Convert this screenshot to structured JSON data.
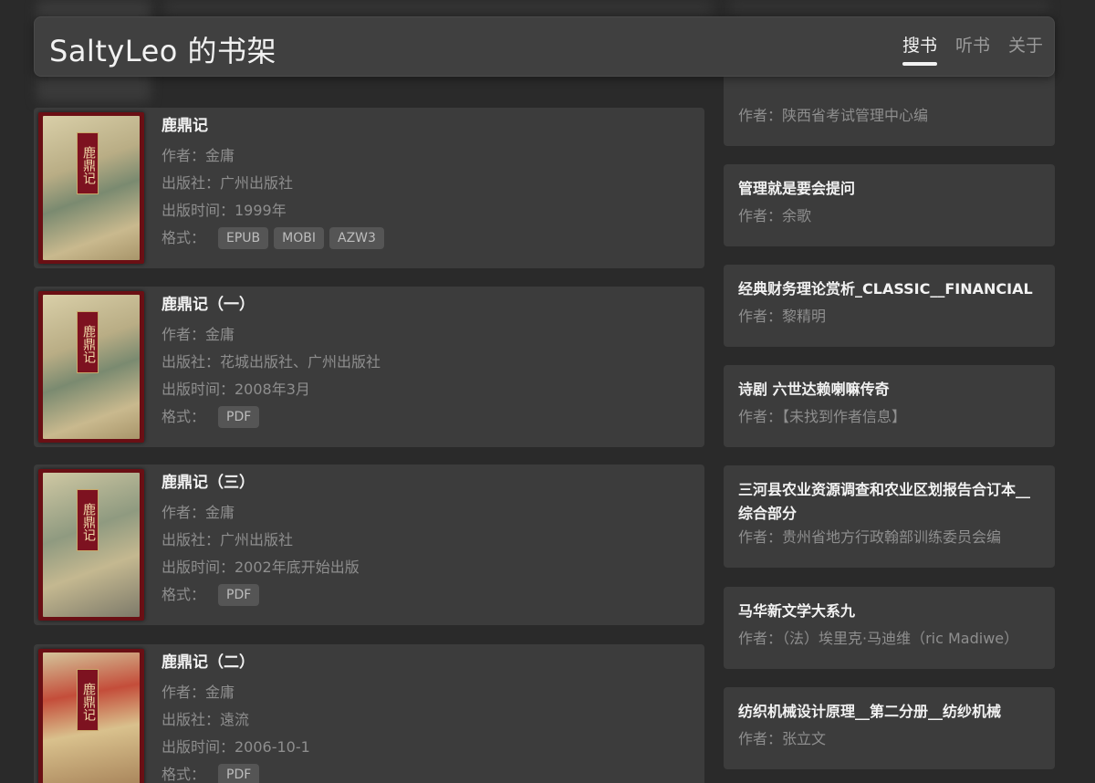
{
  "header": {
    "site_title": "SaltyLeo 的书架",
    "nav": [
      {
        "label": "搜书",
        "active": true
      },
      {
        "label": "听书",
        "active": false
      },
      {
        "label": "关于",
        "active": false
      }
    ]
  },
  "books": [
    {
      "title": "鹿鼎记",
      "author": "作者：金庸",
      "publisher": "出版社：广州出版社",
      "date": "出版时间：1999年",
      "format_label": "格式：",
      "formats": [
        "EPUB",
        "MOBI",
        "AZW3"
      ],
      "cover_text": "鹿鼎记"
    },
    {
      "title": "鹿鼎记（一）",
      "author": "作者：金庸",
      "publisher": "出版社：花城出版社、广州出版社",
      "date": "出版时间：2008年3月",
      "format_label": "格式：",
      "formats": [
        "PDF"
      ],
      "cover_text": "鹿鼎记"
    },
    {
      "title": "鹿鼎记（三）",
      "author": "作者：金庸",
      "publisher": "出版社：广州出版社",
      "date": "出版时间：2002年底开始出版",
      "format_label": "格式：",
      "formats": [
        "PDF"
      ],
      "cover_text": "鹿鼎记"
    },
    {
      "title": "鹿鼎记（二）",
      "author": "作者：金庸",
      "publisher": "出版社：遠流",
      "date": "出版时间：2006-10-1",
      "format_label": "格式：",
      "formats": [
        "PDF"
      ],
      "cover_text": "鹿鼎记"
    }
  ],
  "side": [
    {
      "title": "",
      "author": "作者：陕西省考试管理中心编"
    },
    {
      "title": "管理就是要会提问",
      "author": "作者：余歌"
    },
    {
      "title": "经典财务理论赏析_CLASSIC__FINANCIAL",
      "author": "作者：黎精明"
    },
    {
      "title": "诗剧 六世达赖喇嘛传奇",
      "author": "作者：【未找到作者信息】"
    },
    {
      "title": "三河县农业资源调查和农业区划报告合订本__综合部分",
      "author": "作者：贵州省地方行政翰部训练委员会编"
    },
    {
      "title": "马华新文学大系九",
      "author": "作者：（法）埃里克·马迪维（ric Madiwe）"
    },
    {
      "title": "纺织机械设计原理__第二分册__纺纱机械",
      "author": "作者：张立文"
    }
  ]
}
